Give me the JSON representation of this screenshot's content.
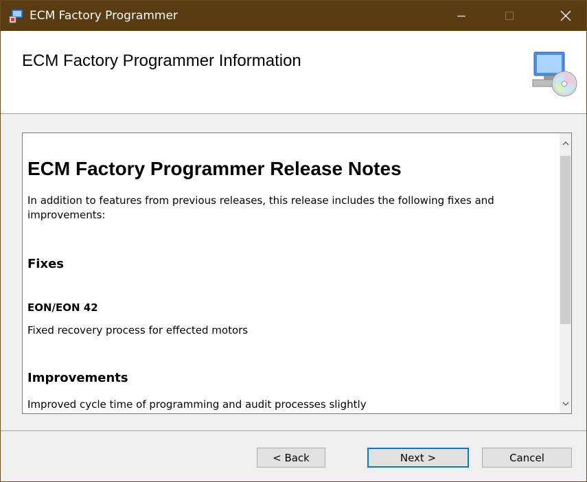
{
  "window": {
    "title": "ECM Factory Programmer",
    "titlebar_color": "#5a3c12",
    "controls": [
      "minimize",
      "maximize",
      "close"
    ]
  },
  "header": {
    "title": "ECM Factory Programmer Information",
    "icon": "computer-cd-icon"
  },
  "release_notes": {
    "heading": "ECM Factory Programmer Release Notes",
    "intro": "In addition to features from previous releases, this release includes the following fixes and improvements:",
    "fixes_heading": "Fixes",
    "fix_subheading": "EON/EON 42",
    "fix_item": "Fixed recovery process for effected motors",
    "improvements_heading": "Improvements",
    "improvement_item": "Improved cycle time of programming and audit processes slightly"
  },
  "buttons": {
    "back": "< Back",
    "next": "Next >",
    "cancel": "Cancel",
    "focus_color": "#0078d7"
  }
}
